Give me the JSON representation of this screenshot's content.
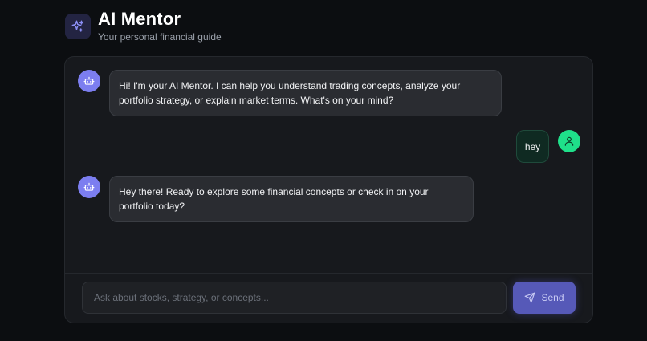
{
  "header": {
    "icon": "sparkles-icon",
    "title": "AI Mentor",
    "subtitle": "Your personal financial guide"
  },
  "messages": [
    {
      "role": "assistant",
      "avatar_icon": "bot-icon",
      "text": "Hi! I'm your AI Mentor. I can help you understand trading concepts, analyze your portfolio strategy, or explain market terms. What's on your mind?"
    },
    {
      "role": "user",
      "avatar_icon": "user-icon",
      "text": "hey"
    },
    {
      "role": "assistant",
      "avatar_icon": "bot-icon",
      "text": "Hey there! Ready to explore some financial concepts or check in on your portfolio today?"
    }
  ],
  "composer": {
    "placeholder": "Ask about stocks, strategy, or concepts...",
    "value": "",
    "send_label": "Send",
    "send_icon": "send-icon"
  },
  "colors": {
    "background": "#0c0e11",
    "panel": "#17191d",
    "assistant_avatar": "#7c7ef0",
    "user_avatar": "#1fe08a",
    "send_button": "#5659b8"
  }
}
